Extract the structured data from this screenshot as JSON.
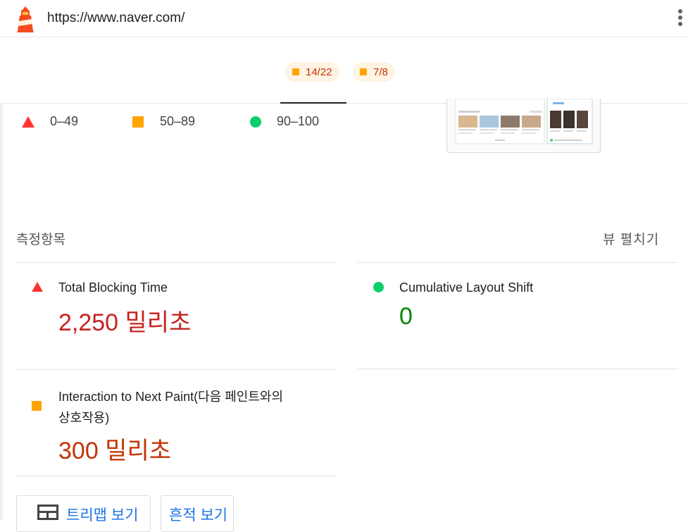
{
  "header": {
    "url": "https://www.naver.com/"
  },
  "gauges": {
    "pill_1": "14/22",
    "pill_2": "7/8"
  },
  "legend": {
    "fail": "0–49",
    "average": "50–89",
    "pass": "90–100"
  },
  "metrics_section": {
    "title": "측정항목",
    "expand_label": "뷰 펼치기"
  },
  "metrics": [
    {
      "name": "Total Blocking Time",
      "value": "2,250 밀리초",
      "rating": "fail",
      "color": "#c7221f"
    },
    {
      "name": "Cumulative Layout Shift",
      "value": "0",
      "rating": "pass",
      "color": "#008800"
    },
    {
      "name_line1": "Interaction to Next Paint(다음 페인트와의",
      "name_line2": "상호작용)",
      "value": "300 밀리초",
      "rating": "average",
      "color": "#c33300"
    }
  ],
  "buttons": {
    "treemap": "트리맵 보기",
    "trace": "흔적 보기"
  },
  "colors": {
    "fail": "#ff3333",
    "average": "#ffa400",
    "pass": "#0cce6b",
    "link": "#1a73e8"
  }
}
